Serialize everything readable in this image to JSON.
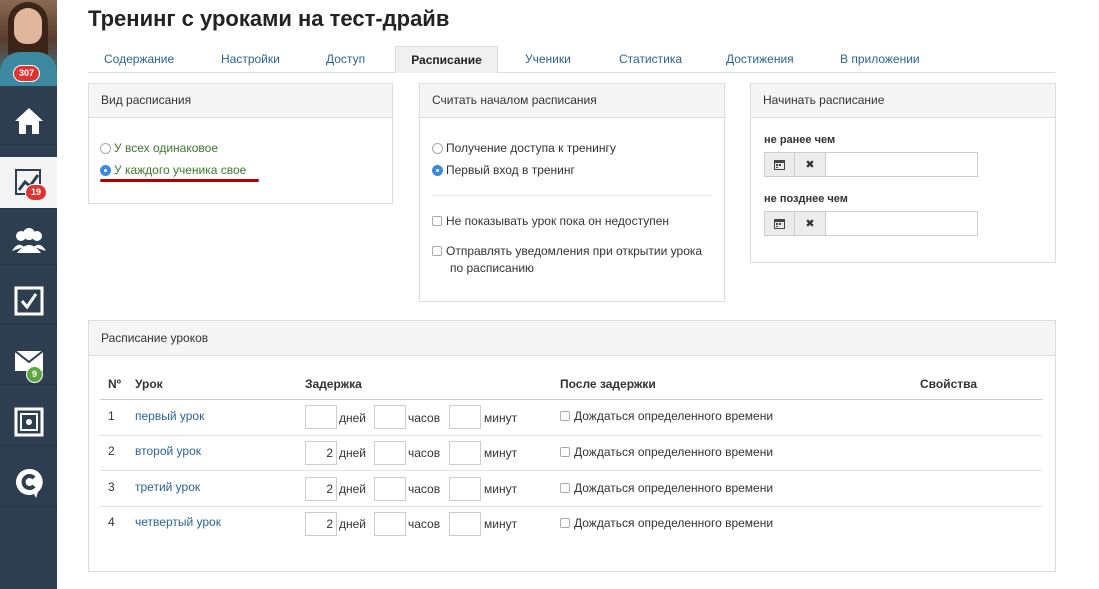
{
  "sidebar": {
    "avatar_badge": "307",
    "stats_badge": "19",
    "mail_badge": "9"
  },
  "header": {
    "title": "Тренинг с уроками на тест-драйв"
  },
  "tabs": [
    {
      "label": "Содержание"
    },
    {
      "label": "Настройки"
    },
    {
      "label": "Доступ"
    },
    {
      "label": "Расписание"
    },
    {
      "label": "Ученики"
    },
    {
      "label": "Статистика"
    },
    {
      "label": "Достижения"
    },
    {
      "label": "В приложении"
    }
  ],
  "schedule_type": {
    "title": "Вид расписания",
    "options": [
      "У всех одинаковое",
      "У каждого ученика свое"
    ]
  },
  "schedule_start": {
    "title": "Считать началом расписания",
    "options": [
      "Получение доступа к тренингу",
      "Первый вход в тренинг"
    ],
    "checks": [
      "Не показывать урок пока он недоступен",
      "Отправлять уведомления при открытии урока",
      "по расписанию"
    ]
  },
  "schedule_begin": {
    "title": "Начинать расписание",
    "not_before": "не ранее чем",
    "not_after": "не позднее чем",
    "clear_glyph": "✖"
  },
  "lessons": {
    "title": "Расписание уроков",
    "headers": {
      "num": "Nº",
      "lesson": "Урок",
      "delay": "Задержка",
      "after": "После задержки",
      "props": "Свойства"
    },
    "units": {
      "days": "дней",
      "hours": "часов",
      "minutes": "минут"
    },
    "wait_label": "Дождаться определенного времени",
    "rows": [
      {
        "num": "1",
        "name": "первый урок",
        "days": ""
      },
      {
        "num": "2",
        "name": "второй урок",
        "days": "2"
      },
      {
        "num": "3",
        "name": "третий урок",
        "days": "2"
      },
      {
        "num": "4",
        "name": "четвертый урок",
        "days": "2"
      }
    ]
  }
}
